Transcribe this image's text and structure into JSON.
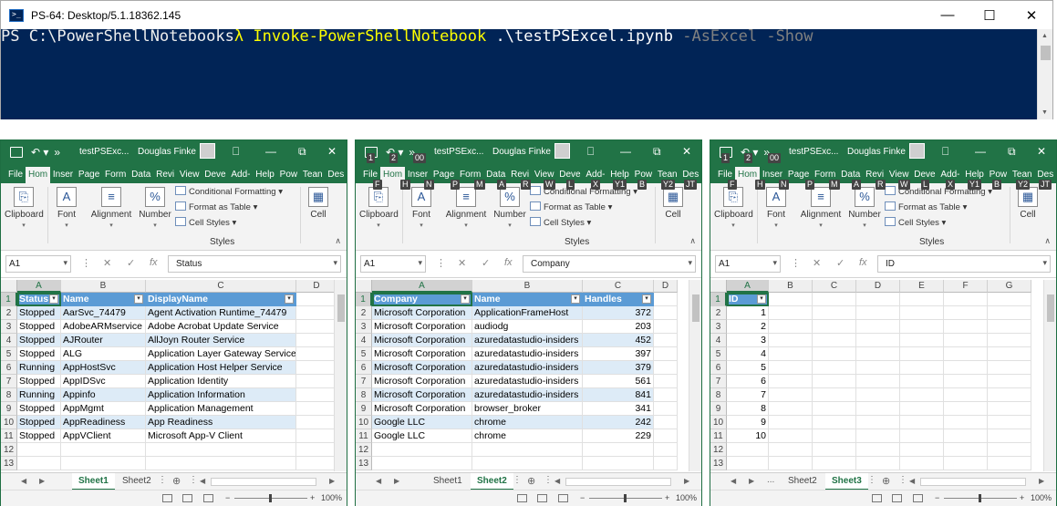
{
  "powershell": {
    "title": "PS-64: Desktop/5.1.18362.145",
    "prompt": "PS C:\\PowerShellNotebooks",
    "lambda": "λ",
    "command": "Invoke-PowerShellNotebook",
    "argument": ".\\testPSExcel.ipynb",
    "params": "-AsExcel -Show",
    "minimize": "—",
    "maximize": "☐",
    "close": "✕"
  },
  "excel_common": {
    "filename": "testPSExc...",
    "user": "Douglas Finke",
    "ribbon_tabs": [
      "File",
      "Hom",
      "Inser",
      "Page",
      "Form",
      "Data",
      "Revi",
      "View",
      "Deve",
      "Add-",
      "Help",
      "Pow",
      "Tean",
      "Des"
    ],
    "groups": {
      "clipboard": "Clipboard",
      "font": "Font",
      "alignment": "Alignment",
      "number": "Number",
      "conditional": "Conditional Formatting",
      "format_table": "Format as Table",
      "cell_styles": "Cell Styles",
      "styles": "Styles",
      "cells": "Cell"
    },
    "namebox": "A1",
    "zoom": "100%",
    "fx": "fx",
    "ellipsis": "..."
  },
  "keytips": {
    "title": [
      "1",
      "2",
      "00"
    ],
    "tabs": [
      "F",
      "H",
      "N",
      "P",
      "M",
      "A",
      "R",
      "W",
      "L",
      "X",
      "Y1",
      "B",
      "Y2",
      "JT"
    ]
  },
  "windows": [
    {
      "formula": "Status",
      "columns": [
        "A",
        "B",
        "C",
        "D"
      ],
      "headers": [
        "Status",
        "Name",
        "DisplayName"
      ],
      "rows": [
        [
          "Stopped",
          "AarSvc_74479",
          "Agent Activation Runtime_74479"
        ],
        [
          "Stopped",
          "AdobeARMservice",
          "Adobe Acrobat Update Service"
        ],
        [
          "Stopped",
          "AJRouter",
          "AllJoyn Router Service"
        ],
        [
          "Stopped",
          "ALG",
          "Application Layer Gateway Service"
        ],
        [
          "Running",
          "AppHostSvc",
          "Application Host Helper Service"
        ],
        [
          "Stopped",
          "AppIDSvc",
          "Application Identity"
        ],
        [
          "Running",
          "Appinfo",
          "Application Information"
        ],
        [
          "Stopped",
          "AppMgmt",
          "Application Management"
        ],
        [
          "Stopped",
          "AppReadiness",
          "App Readiness"
        ],
        [
          "Stopped",
          "AppVClient",
          "Microsoft App-V Client"
        ]
      ],
      "sheets": [
        "Sheet1",
        "Sheet2"
      ],
      "active_sheet": "Sheet1"
    },
    {
      "formula": "Company",
      "columns": [
        "A",
        "B",
        "C",
        "D"
      ],
      "headers": [
        "Company",
        "Name",
        "Handles"
      ],
      "rows": [
        [
          "Microsoft Corporation",
          "ApplicationFrameHost",
          "372"
        ],
        [
          "Microsoft Corporation",
          "audiodg",
          "203"
        ],
        [
          "Microsoft Corporation",
          "azuredatastudio-insiders",
          "452"
        ],
        [
          "Microsoft Corporation",
          "azuredatastudio-insiders",
          "397"
        ],
        [
          "Microsoft Corporation",
          "azuredatastudio-insiders",
          "379"
        ],
        [
          "Microsoft Corporation",
          "azuredatastudio-insiders",
          "561"
        ],
        [
          "Microsoft Corporation",
          "azuredatastudio-insiders",
          "841"
        ],
        [
          "Microsoft Corporation",
          "browser_broker",
          "341"
        ],
        [
          "Google LLC",
          "chrome",
          "242"
        ],
        [
          "Google LLC",
          "chrome",
          "229"
        ]
      ],
      "sheets": [
        "Sheet1",
        "Sheet2"
      ],
      "active_sheet": "Sheet2"
    },
    {
      "formula": "ID",
      "columns": [
        "A",
        "B",
        "C",
        "D",
        "E",
        "F",
        "G"
      ],
      "headers": [
        "ID"
      ],
      "rows": [
        [
          "1"
        ],
        [
          "2"
        ],
        [
          "3"
        ],
        [
          "4"
        ],
        [
          "5"
        ],
        [
          "6"
        ],
        [
          "7"
        ],
        [
          "8"
        ],
        [
          "9"
        ],
        [
          "10"
        ]
      ],
      "sheets": [
        "Sheet2",
        "Sheet3"
      ],
      "active_sheet": "Sheet3"
    }
  ],
  "row_numbers": [
    "1",
    "2",
    "3",
    "4",
    "5",
    "6",
    "7",
    "8",
    "9",
    "10",
    "11",
    "12",
    "13"
  ]
}
